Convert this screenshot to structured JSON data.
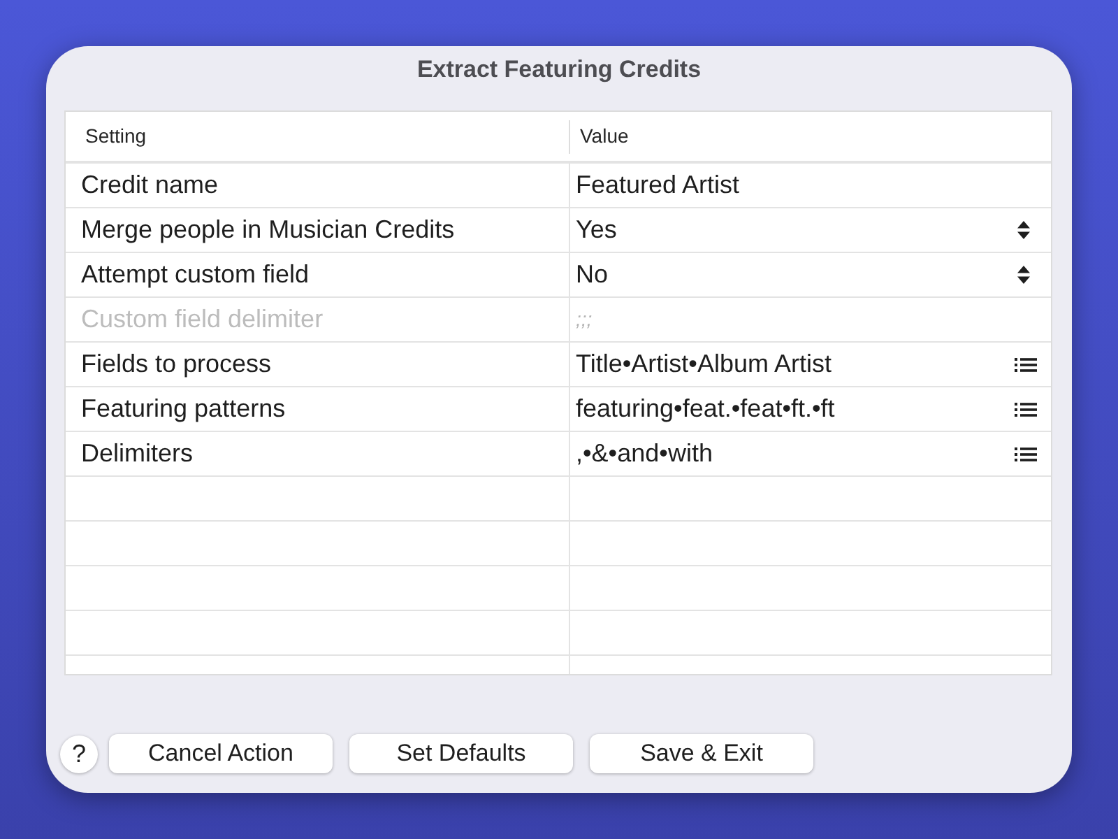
{
  "window": {
    "title": "Extract Featuring Credits"
  },
  "table": {
    "columns": [
      "Setting",
      "Value"
    ],
    "rows": [
      {
        "setting": "Credit name",
        "value": "Featured Artist",
        "kind": "text",
        "disabled": false
      },
      {
        "setting": "Merge people in Musician Credits",
        "value": "Yes",
        "kind": "popup",
        "disabled": false
      },
      {
        "setting": "Attempt custom field",
        "value": "No",
        "kind": "popup",
        "disabled": false
      },
      {
        "setting": "Custom field delimiter",
        "value": ";;;",
        "kind": "text",
        "disabled": true
      },
      {
        "setting": "Fields to process",
        "value": "Title•Artist•Album Artist",
        "kind": "list",
        "disabled": false
      },
      {
        "setting": "Featuring patterns",
        "value": "featuring•feat.•feat•ft.•ft",
        "kind": "list",
        "disabled": false
      },
      {
        "setting": "Delimiters",
        "value": ",•&•and•with",
        "kind": "list",
        "disabled": false
      }
    ]
  },
  "help_button": "?",
  "buttons": [
    "Cancel Action",
    "Set Defaults",
    "Save & Exit"
  ]
}
